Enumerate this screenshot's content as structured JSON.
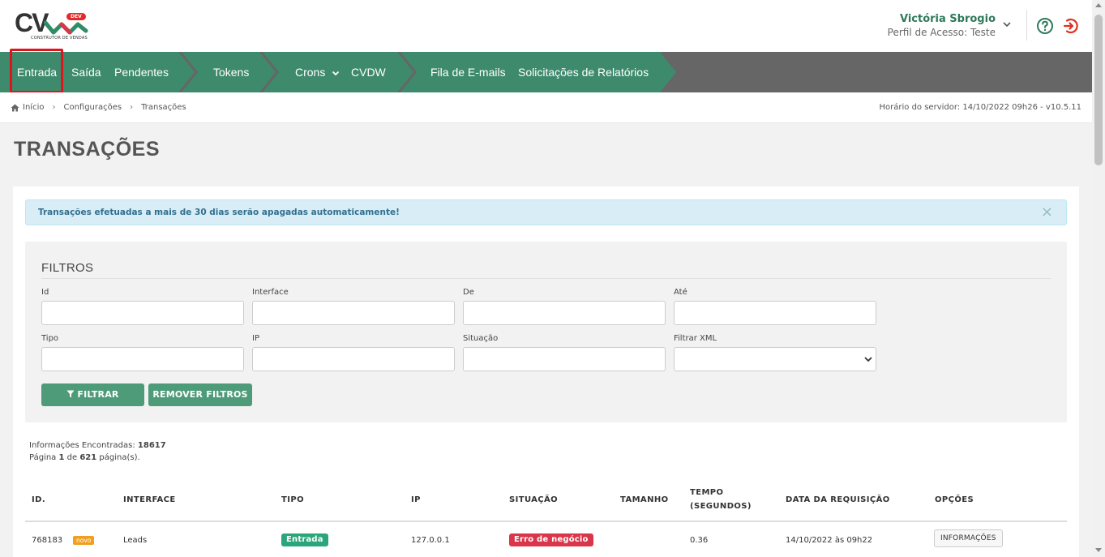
{
  "logo": {
    "letters": "CV",
    "badge": "DEV",
    "subtitle": "CONSTRUTOR DE VENDAS"
  },
  "user": {
    "name": "Victória Sbrogio",
    "profile": "Perfil de Acesso: Teste"
  },
  "nav": {
    "items": [
      {
        "label": "Entrada"
      },
      {
        "label": "Saída"
      },
      {
        "label": "Pendentes"
      },
      {
        "label": "Tokens"
      },
      {
        "label": "Crons"
      },
      {
        "label": "CVDW"
      },
      {
        "label": "Fila de E-mails"
      },
      {
        "label": "Solicitações de Relatórios"
      }
    ],
    "colors": {
      "segment": "#3e8a6d",
      "bar": "#666666",
      "active_outline": "#e0141e"
    }
  },
  "breadcrumb": {
    "items": [
      "Início",
      "Configurações",
      "Transações"
    ]
  },
  "server_time": "Horário do servidor: 14/10/2022 09h26 - v10.5.11",
  "page_title": "TRANSAÇÕES",
  "alert": {
    "text": "Transações efetuadas a mais de 30 dias serão apagadas automaticamente!",
    "close": "×"
  },
  "filters": {
    "title": "FILTROS",
    "fields": {
      "id": {
        "label": "Id",
        "value": ""
      },
      "interface": {
        "label": "Interface",
        "value": ""
      },
      "de": {
        "label": "De",
        "value": ""
      },
      "ate": {
        "label": "Até",
        "value": ""
      },
      "tipo": {
        "label": "Tipo",
        "value": ""
      },
      "ip": {
        "label": "IP",
        "value": ""
      },
      "situacao": {
        "label": "Situação",
        "value": ""
      },
      "xml": {
        "label": "Filtrar XML",
        "selected": ""
      }
    },
    "filter_button": "FILTRAR",
    "remove_button": "REMOVER FILTROS"
  },
  "results": {
    "found_label": "Informações Encontradas:",
    "found_count": "18617",
    "page_prefix": "Página",
    "page_current": "1",
    "page_of": "de",
    "page_total": "621",
    "page_suffix": "página(s)."
  },
  "table": {
    "headers": {
      "id": "ID.",
      "interface": "INTERFACE",
      "tipo": "TIPO",
      "ip": "IP",
      "situacao": "SITUAÇÃO",
      "tamanho": "TAMANHO",
      "tempo_1": "TEMPO",
      "tempo_2": "(SEGUNDOS)",
      "data": "DATA DA REQUISIÇÃO",
      "opcoes": "OPÇÕES"
    },
    "rows": [
      {
        "id": "768183",
        "badge": "novo",
        "interface": "Leads",
        "tipo": "Entrada",
        "ip": "127.0.0.1",
        "situacao": "Erro de negócio",
        "tamanho": "",
        "tempo": "0.36",
        "data": "14/10/2022 às 09h22",
        "opcoes": "INFORMAÇÕES"
      }
    ]
  }
}
